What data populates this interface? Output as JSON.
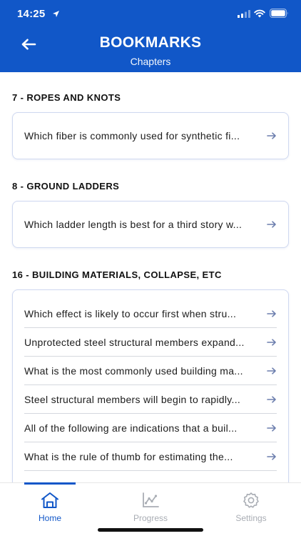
{
  "status_bar": {
    "time": "14:25"
  },
  "header": {
    "title": "BOOKMARKS",
    "subtitle": "Chapters"
  },
  "sections": [
    {
      "title": "7 - ROPES AND KNOTS",
      "items": [
        "Which fiber is commonly used for synthetic fi..."
      ]
    },
    {
      "title": "8 - GROUND LADDERS",
      "items": [
        "Which ladder length is best for a third story w..."
      ]
    },
    {
      "title": "16 - BUILDING MATERIALS, COLLAPSE, ETC",
      "items": [
        "Which effect is likely to occur first when stru...",
        "Unprotected steel structural members expand...",
        "What is the most commonly used building ma...",
        "Steel structural members will begin to rapidly...",
        "All of the following are indications that a buil...",
        "What is the rule of thumb for estimating the..."
      ]
    }
  ],
  "tabbar": {
    "tabs": [
      {
        "label": "Home",
        "icon": "home-icon",
        "active": true
      },
      {
        "label": "Progress",
        "icon": "progress-chart-icon",
        "active": false
      },
      {
        "label": "Settings",
        "icon": "gear-icon",
        "active": false
      }
    ]
  },
  "colors": {
    "brand": "#1157c8",
    "tab_active": "#1157c8",
    "tab_inactive": "#a9adb4",
    "arrow": "#6d7fae"
  }
}
